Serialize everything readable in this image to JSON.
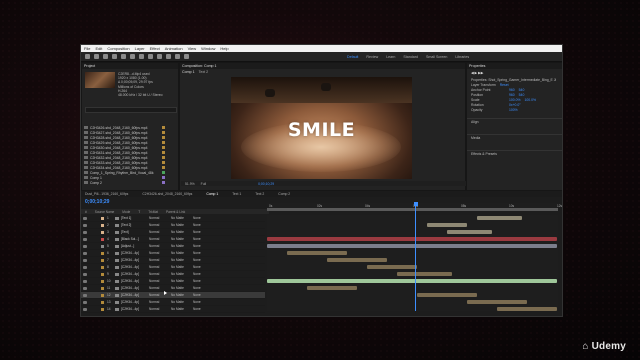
{
  "menu": [
    "File",
    "Edit",
    "Composition",
    "Layer",
    "Effect",
    "Animation",
    "View",
    "Window",
    "Help"
  ],
  "workspaces": [
    "Default",
    "Review",
    "Learn",
    "Standard",
    "Small Screen",
    "Libraries"
  ],
  "project": {
    "tab": "Project",
    "selected_file": "C2ER8...d.Mp4 used",
    "info": [
      "1920 x 1080 (1.00)",
      "Δ 0;00;05;09, 29.97 fps",
      "Millions of Colors",
      "H.264",
      "48.000 kHz / 32 bit U / Stereo"
    ],
    "files": [
      "C2H3426-shd_2048_2160_60fps.mp4",
      "C2H3427-shd_2048_2160_60fps.mp4",
      "C2H3428-shd_2048_2160_60fps.mp4",
      "C2H3429-shd_2048_2160_60fps.mp4",
      "C2H3430-shd_2048_2160_60fps.mp4",
      "C2H3431-shd_2048_2160_60fps.mp4",
      "C2H3432-shd_2048_2160_60fps.mp4",
      "C2H3433-shd_2048_2160_60fps.mp4",
      "C2H3434-shd_2048_2160_60fps.mp4",
      "Comp_1_Spring_Rhythm_Bird_Vocal_48k",
      "Comp 1",
      "Comp 2"
    ]
  },
  "composition": {
    "tab": "Composition: Comp 1",
    "subtabs": [
      "Comp 1",
      "Text 2"
    ],
    "title_text": "SMILE",
    "zoom": "51.9%",
    "resolution": "Full",
    "timecode": "0;00;10;29"
  },
  "right_panel": {
    "tab": "Properties",
    "layer_label": "Properties: Shot_Spring_Gamer_Intermediate_Bing_E Ji",
    "section": "Layer Transform",
    "reset": "Reset",
    "props": [
      {
        "name": "Anchor Point",
        "v1": "960",
        "v2": "540"
      },
      {
        "name": "Position",
        "v1": "960",
        "v2": "540"
      },
      {
        "name": "Scale",
        "v1": "100.0%",
        "v2": "100.0%"
      },
      {
        "name": "Rotation",
        "v1": "0x+0.0°",
        "v2": ""
      },
      {
        "name": "Opacity",
        "v1": "100%",
        "v2": ""
      }
    ],
    "sections": [
      "Align",
      "Media",
      "Effects & Presets"
    ]
  },
  "timeline": {
    "tabs": [
      "Dust_Pill...1936_2160_60fps",
      "C2H3426-shd_2048_2160_60fps",
      "Comp 1",
      "Text 1",
      "Text 2",
      "Comp 2"
    ],
    "active_tab": "Comp 1",
    "timecode": "0;00;10;29",
    "columns": [
      "#",
      "Source Name",
      "Mode",
      "T",
      "TrkMat",
      "Parent & Link"
    ],
    "layers": [
      {
        "num": "1",
        "name": "[Text 1]",
        "mode": "Normal",
        "mat": "No Matte",
        "parent": "None"
      },
      {
        "num": "2",
        "name": "[Text 2]",
        "mode": "Normal",
        "mat": "No Matte",
        "parent": "None"
      },
      {
        "num": "3",
        "name": "[Text]",
        "mode": "Normal",
        "mat": "No Matte",
        "parent": "None"
      },
      {
        "num": "4",
        "name": "[Black Sol...]",
        "mode": "Normal",
        "mat": "No Matte",
        "parent": "None"
      },
      {
        "num": "5",
        "name": "[Adjust...]",
        "mode": "Normal",
        "mat": "No Matte",
        "parent": "None"
      },
      {
        "num": "6",
        "name": "[C2H34...4p]",
        "mode": "Normal",
        "mat": "No Matte",
        "parent": "None"
      },
      {
        "num": "7",
        "name": "[C2H34...4p]",
        "mode": "Normal",
        "mat": "No Matte",
        "parent": "None"
      },
      {
        "num": "8",
        "name": "[C2H34...4p]",
        "mode": "Normal",
        "mat": "No Matte",
        "parent": "None"
      },
      {
        "num": "9",
        "name": "[C2H34...4p]",
        "mode": "Normal",
        "mat": "No Matte",
        "parent": "None"
      },
      {
        "num": "10",
        "name": "[C2H34...4p]",
        "mode": "Normal",
        "mat": "No Matte",
        "parent": "None"
      },
      {
        "num": "11",
        "name": "[C2H34...4p]",
        "mode": "Normal",
        "mat": "No Matte",
        "parent": "None"
      },
      {
        "num": "12",
        "name": "[C2H34...4p]",
        "mode": "Normal",
        "mat": "No Matte",
        "parent": "None"
      },
      {
        "num": "13",
        "name": "[C2H34...4p]",
        "mode": "Normal",
        "mat": "No Matte",
        "parent": "None"
      },
      {
        "num": "14",
        "name": "[C2H34...4p]",
        "mode": "Normal",
        "mat": "No Matte",
        "parent": "None"
      }
    ],
    "ruler": [
      "0s",
      "02s",
      "04s",
      "06s",
      "08s",
      "10s",
      "12s"
    ]
  },
  "brand": "Udemy",
  "colors": {
    "accent": "#3d8fff",
    "menubar": "#f1f1f1",
    "panel": "#232323"
  }
}
